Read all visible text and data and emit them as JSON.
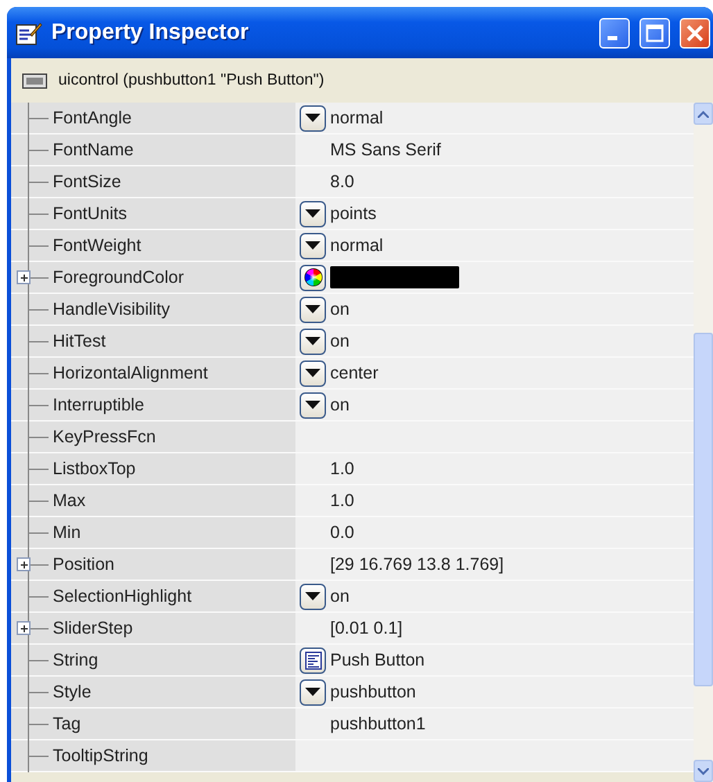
{
  "window": {
    "title": "Property Inspector"
  },
  "object_header": {
    "label": "uicontrol (pushbutton1 \"Push Button\")"
  },
  "properties": [
    {
      "name": "FontAngle",
      "kind": "dropdown",
      "value": "normal"
    },
    {
      "name": "FontName",
      "kind": "text",
      "value": "MS Sans Serif"
    },
    {
      "name": "FontSize",
      "kind": "text",
      "value": "8.0"
    },
    {
      "name": "FontUnits",
      "kind": "dropdown",
      "value": "points"
    },
    {
      "name": "FontWeight",
      "kind": "dropdown",
      "value": "normal"
    },
    {
      "name": "ForegroundColor",
      "kind": "color",
      "color": "#000000",
      "expanded": false
    },
    {
      "name": "HandleVisibility",
      "kind": "dropdown",
      "value": "on"
    },
    {
      "name": "HitTest",
      "kind": "dropdown",
      "value": "on"
    },
    {
      "name": "HorizontalAlignment",
      "kind": "dropdown",
      "value": "center"
    },
    {
      "name": "Interruptible",
      "kind": "dropdown",
      "value": "on"
    },
    {
      "name": "KeyPressFcn",
      "kind": "text"
    },
    {
      "name": "ListboxTop",
      "kind": "text",
      "value": "1.0"
    },
    {
      "name": "Max",
      "kind": "text",
      "value": "1.0"
    },
    {
      "name": "Min",
      "kind": "text",
      "value": "0.0"
    },
    {
      "name": "Position",
      "kind": "text",
      "value": "[29 16.769 13.8 1.769]",
      "expanded": false
    },
    {
      "name": "SelectionHighlight",
      "kind": "dropdown",
      "value": "on"
    },
    {
      "name": "SliderStep",
      "kind": "text",
      "value": "[0.01 0.1]",
      "expanded": false
    },
    {
      "name": "String",
      "kind": "editor",
      "value": "Push Button"
    },
    {
      "name": "Style",
      "kind": "dropdown",
      "value": "pushbutton"
    },
    {
      "name": "Tag",
      "kind": "text",
      "value": "pushbutton1"
    },
    {
      "name": "TooltipString",
      "kind": "text"
    }
  ]
}
